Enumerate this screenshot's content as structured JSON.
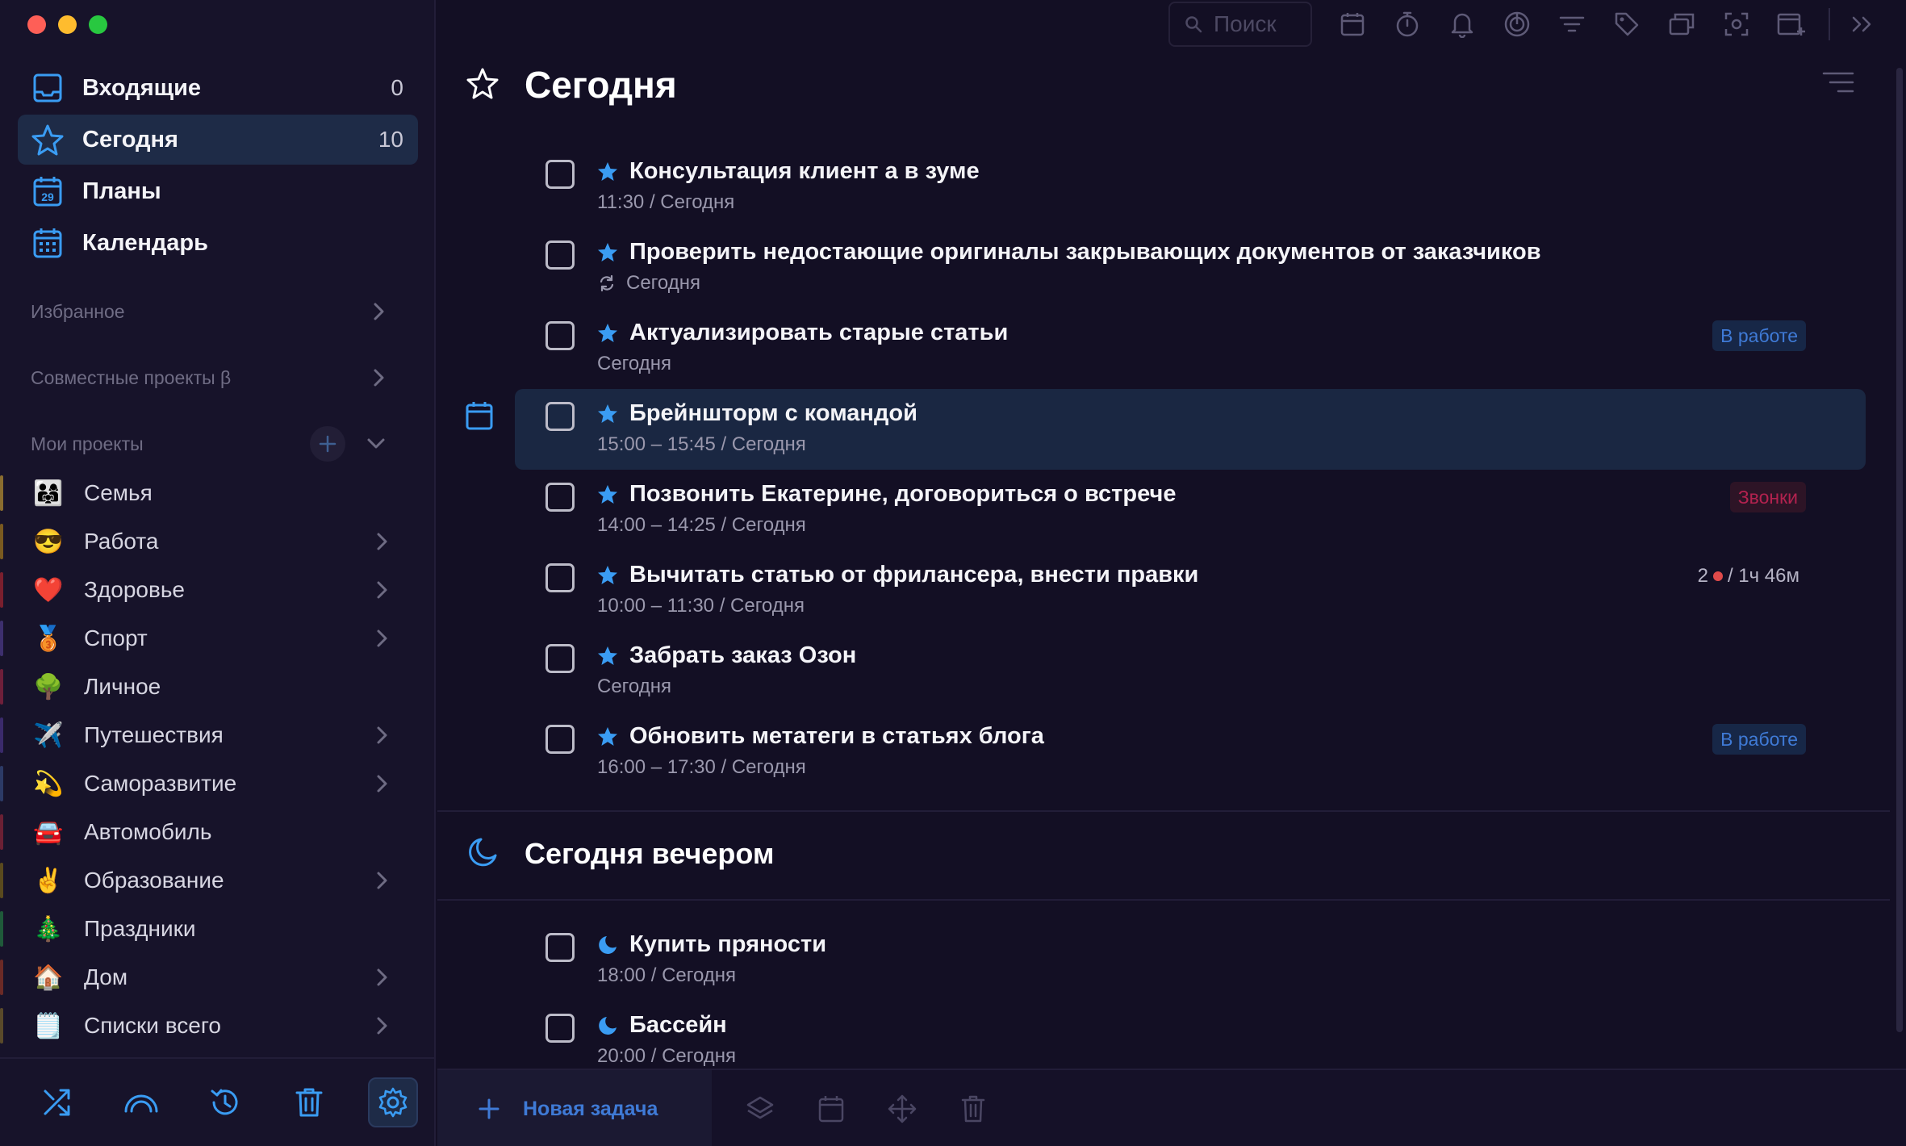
{
  "colors": {
    "accent": "#3a9cf3",
    "sidebar_bg": "#17132a",
    "main_bg": "#130f24",
    "active_item": "#1e2b47",
    "badge_work_text": "#3f7ad6",
    "badge_calls_text": "#b3224f"
  },
  "sidebar": {
    "nav": [
      {
        "label": "Входящие",
        "count": "0",
        "icon": "inbox-icon"
      },
      {
        "label": "Сегодня",
        "count": "10",
        "icon": "star-icon",
        "active": true
      },
      {
        "label": "Планы",
        "count": "",
        "icon": "calendar-29-icon"
      },
      {
        "label": "Календарь",
        "count": "",
        "icon": "calendar-grid-icon"
      }
    ],
    "favorites_label": "Избранное",
    "shared_label": "Совместные проекты β",
    "my_projects_label": "Мои проекты",
    "projects": [
      {
        "name": "Семья",
        "emoji": "👨‍👩‍👧",
        "color": "#8a6d2f",
        "has_children": false
      },
      {
        "name": "Работа",
        "emoji": "😎",
        "color": "#7a5a20",
        "has_children": true
      },
      {
        "name": "Здоровье",
        "emoji": "❤️",
        "color": "#7a1f2e",
        "has_children": true
      },
      {
        "name": "Спорт",
        "emoji": "🥉",
        "color": "#3d2f6e",
        "has_children": true
      },
      {
        "name": "Личное",
        "emoji": "🌳",
        "color": "#6e1f3a",
        "has_children": false
      },
      {
        "name": "Путешествия",
        "emoji": "✈️",
        "color": "#3a2a6b",
        "has_children": true
      },
      {
        "name": "Саморазвитие",
        "emoji": "💫",
        "color": "#2c3a66",
        "has_children": true
      },
      {
        "name": "Автомобиль",
        "emoji": "🚘",
        "color": "#6b2034",
        "has_children": false
      },
      {
        "name": "Образование",
        "emoji": "✌️",
        "color": "#5a4a1e",
        "has_children": true
      },
      {
        "name": "Праздники",
        "emoji": "🎄",
        "color": "#1f5a3a",
        "has_children": false
      },
      {
        "name": "Дом",
        "emoji": "🏠",
        "color": "#6b2a26",
        "has_children": true
      },
      {
        "name": "Списки всего",
        "emoji": "🗒️",
        "color": "#5a4a2a",
        "has_children": true
      }
    ]
  },
  "toolbar": {
    "search_placeholder": "Поиск",
    "icons": [
      "calendar-icon",
      "timer-icon",
      "bell-icon",
      "focus-icon",
      "filter-icon",
      "tag-icon",
      "coffee-icon",
      "screenshot-icon",
      "add-window-icon"
    ]
  },
  "main": {
    "title": "Сегодня",
    "tasks": [
      {
        "title": "Консультация клиент а в зуме",
        "meta": "11:30 / Сегодня"
      },
      {
        "title": "Проверить недостающие оригиналы закрывающих документов от заказчиков",
        "meta": "Сегодня",
        "repeat": true
      },
      {
        "title": "Актуализировать старые статьи",
        "meta": "Сегодня",
        "badge": "В работе",
        "badge_type": "work"
      },
      {
        "title": "Брейншторм с командой",
        "meta": "15:00 – 15:45 / Сегодня",
        "highlight": true
      },
      {
        "title": "Позвонить Екатерине, договориться о встрече",
        "meta": "14:00 – 14:25 / Сегодня",
        "badge": "Звонки",
        "badge_type": "calls"
      },
      {
        "title": "Вычитать статью от фрилансера, внести правки",
        "meta": "10:00 – 11:30 / Сегодня",
        "timer_count": "2",
        "timer_text": "/ 1ч 46м"
      },
      {
        "title": "Забрать заказ Озон",
        "meta": "Сегодня"
      },
      {
        "title": "Обновить метатеги в статьях блога",
        "meta": "16:00 – 17:30 / Сегодня",
        "badge": "В работе",
        "badge_type": "work"
      }
    ],
    "evening_title": "Сегодня вечером",
    "evening_tasks": [
      {
        "title": "Купить пряности",
        "meta": "18:00 / Сегодня"
      },
      {
        "title": "Бассейн",
        "meta": "20:00 / Сегодня"
      }
    ]
  },
  "bottombar": {
    "new_task_label": "Новая задача"
  }
}
